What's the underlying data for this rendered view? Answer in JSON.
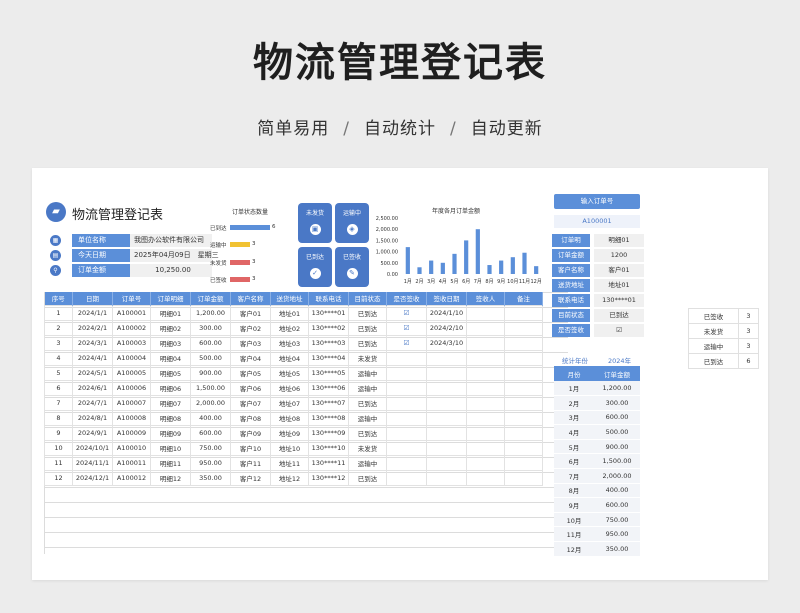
{
  "hero": {
    "title": "物流管理登记表",
    "sub1": "简单易用",
    "sub2": "自动统计",
    "sub3": "自动更新",
    "sep": "/"
  },
  "doc": {
    "title": "物流管理登记表",
    "icon": "truck-icon"
  },
  "info": [
    {
      "label": "单位名称",
      "value": "我图办公软件有限公司",
      "icon": "building-icon"
    },
    {
      "label": "今天日期",
      "value": "2025年04月09日　星期三",
      "icon": "calendar-icon"
    },
    {
      "label": "订单金额",
      "value": "10,250.00",
      "icon": "search-icon"
    }
  ],
  "status_chart": {
    "title": "订单状态数量",
    "items": [
      {
        "label": "已到达",
        "value": 6,
        "color": "#5b8fd9"
      },
      {
        "label": "运输中",
        "value": 3,
        "color": "#f1c232"
      },
      {
        "label": "未发货",
        "value": 3,
        "color": "#e06666"
      },
      {
        "label": "已签收",
        "value": 3,
        "color": "#e06666"
      }
    ]
  },
  "tiles": [
    {
      "label": "未发货",
      "icon": "box-icon"
    },
    {
      "label": "运输中",
      "icon": "layers-icon"
    },
    {
      "label": "已到达",
      "icon": "check-icon"
    },
    {
      "label": "已签收",
      "icon": "sign-icon"
    }
  ],
  "chart_data": {
    "type": "bar",
    "title": "年度各月订单金额",
    "categories": [
      "1月",
      "2月",
      "3月",
      "4月",
      "5月",
      "6月",
      "7月",
      "8月",
      "9月",
      "10月",
      "11月",
      "12月"
    ],
    "values": [
      1200,
      300,
      600,
      500,
      900,
      1500,
      2000,
      400,
      600,
      750,
      950,
      350
    ],
    "yticks": [
      "2,500.00",
      "2,000.00",
      "1,500.00",
      "1,000.00",
      "500.00",
      "0.00"
    ],
    "ylim": [
      0,
      2500
    ],
    "color": "#5b8fd9"
  },
  "table": {
    "headers": [
      "序号",
      "日期",
      "订单号",
      "订单明细",
      "订单金额",
      "客户名称",
      "送货地址",
      "联系电话",
      "目前状态",
      "是否签收",
      "签收日期",
      "签收人",
      "备注"
    ],
    "rows": [
      [
        "1",
        "2024/1/1",
        "A100001",
        "明细01",
        "1,200.00",
        "客户01",
        "地址01",
        "130****01",
        "已到达",
        "☑",
        "2024/1/10",
        "",
        ""
      ],
      [
        "2",
        "2024/2/1",
        "A100002",
        "明细02",
        "300.00",
        "客户02",
        "地址02",
        "130****02",
        "已到达",
        "☑",
        "2024/2/10",
        "",
        ""
      ],
      [
        "3",
        "2024/3/1",
        "A100003",
        "明细03",
        "600.00",
        "客户03",
        "地址03",
        "130****03",
        "已到达",
        "☑",
        "2024/3/10",
        "",
        ""
      ],
      [
        "4",
        "2024/4/1",
        "A100004",
        "明细04",
        "500.00",
        "客户04",
        "地址04",
        "130****04",
        "未发货",
        "",
        "",
        "",
        ""
      ],
      [
        "5",
        "2024/5/1",
        "A100005",
        "明细05",
        "900.00",
        "客户05",
        "地址05",
        "130****05",
        "运输中",
        "",
        "",
        "",
        ""
      ],
      [
        "6",
        "2024/6/1",
        "A100006",
        "明细06",
        "1,500.00",
        "客户06",
        "地址06",
        "130****06",
        "运输中",
        "",
        "",
        "",
        ""
      ],
      [
        "7",
        "2024/7/1",
        "A100007",
        "明细07",
        "2,000.00",
        "客户07",
        "地址07",
        "130****07",
        "已到达",
        "",
        "",
        "",
        ""
      ],
      [
        "8",
        "2024/8/1",
        "A100008",
        "明细08",
        "400.00",
        "客户08",
        "地址08",
        "130****08",
        "运输中",
        "",
        "",
        "",
        ""
      ],
      [
        "9",
        "2024/9/1",
        "A100009",
        "明细09",
        "600.00",
        "客户09",
        "地址09",
        "130****09",
        "已到达",
        "",
        "",
        "",
        ""
      ],
      [
        "10",
        "2024/10/1",
        "A100010",
        "明细10",
        "750.00",
        "客户10",
        "地址10",
        "130****10",
        "未发货",
        "",
        "",
        "",
        ""
      ],
      [
        "11",
        "2024/11/1",
        "A100011",
        "明细11",
        "950.00",
        "客户11",
        "地址11",
        "130****11",
        "运输中",
        "",
        "",
        "",
        ""
      ],
      [
        "12",
        "2024/12/1",
        "A100012",
        "明细12",
        "350.00",
        "客户12",
        "地址12",
        "130****12",
        "已到达",
        "",
        "",
        "",
        ""
      ]
    ]
  },
  "query": {
    "button": "输入订单号",
    "order_id": "A100001",
    "fields": [
      {
        "label": "订单明",
        "value": "明细01"
      },
      {
        "label": "订单金额",
        "value": "1200"
      },
      {
        "label": "客户名称",
        "value": "客户01"
      },
      {
        "label": "送货地址",
        "value": "地址01"
      },
      {
        "label": "联系电话",
        "value": "130****01"
      },
      {
        "label": "目前状态",
        "value": "已到达"
      },
      {
        "label": "是否签收",
        "value": "☑"
      }
    ]
  },
  "monthly": {
    "label": "统计年份",
    "year": "2024年",
    "headers": [
      "月份",
      "订单金额"
    ],
    "rows": [
      [
        "1月",
        "1,200.00"
      ],
      [
        "2月",
        "300.00"
      ],
      [
        "3月",
        "600.00"
      ],
      [
        "4月",
        "500.00"
      ],
      [
        "5月",
        "900.00"
      ],
      [
        "6月",
        "1,500.00"
      ],
      [
        "7月",
        "2,000.00"
      ],
      [
        "8月",
        "400.00"
      ],
      [
        "9月",
        "600.00"
      ],
      [
        "10月",
        "750.00"
      ],
      [
        "11月",
        "950.00"
      ],
      [
        "12月",
        "350.00"
      ]
    ]
  },
  "side_summary": [
    {
      "label": "已签收",
      "value": "3"
    },
    {
      "label": "未发货",
      "value": "3"
    },
    {
      "label": "运输中",
      "value": "3"
    },
    {
      "label": "已到达",
      "value": "6"
    }
  ]
}
